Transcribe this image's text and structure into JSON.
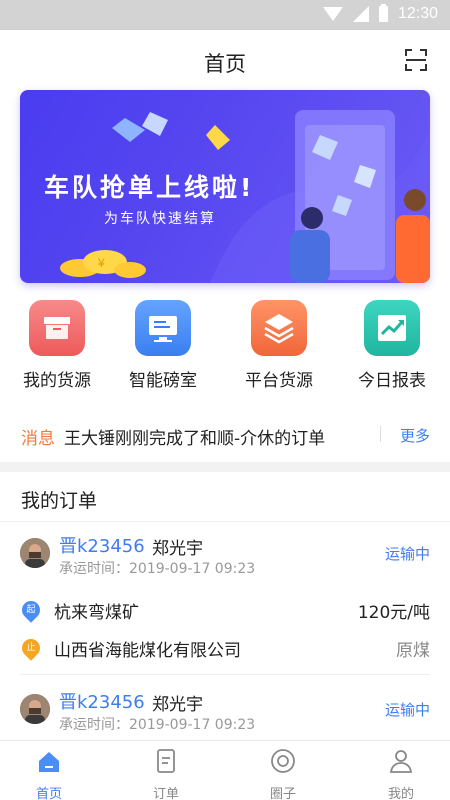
{
  "status_bar": {
    "time": "12:30"
  },
  "header": {
    "title": "首页"
  },
  "banner": {
    "headline": "车队抢单上线啦!",
    "subtitle": "为车队快速结算"
  },
  "quick_actions": [
    {
      "label": "我的货源",
      "icon": "box-icon",
      "color": "#f26a6a"
    },
    {
      "label": "智能磅室",
      "icon": "monitor-icon",
      "color": "#4a8ef5"
    },
    {
      "label": "平台货源",
      "icon": "layers-icon",
      "color": "#f47d52"
    },
    {
      "label": "今日报表",
      "icon": "trend-chart-icon",
      "color": "#2fc5b0"
    }
  ],
  "notice": {
    "tag": "消息",
    "message": "王大锤刚刚完成了和顺-介休的订单",
    "more": "更多"
  },
  "orders_section": {
    "title": "我的订单"
  },
  "orders": [
    {
      "plate": "晋k23456",
      "driver": "郑光宇",
      "time": "承运时间：2019-09-17  09:23",
      "status": "运输中",
      "origin_tag": "起",
      "origin": "杭来弯煤矿",
      "price": "120元/吨",
      "dest_tag": "止",
      "destination": "山西省海能煤化有限公司",
      "cargo": "原煤"
    },
    {
      "plate": "晋k23456",
      "driver": "郑光宇",
      "time": "承运时间：2019-09-17  09:23",
      "status": "运输中"
    }
  ],
  "tabbar": [
    {
      "label": "首页",
      "icon": "home-icon",
      "active": true
    },
    {
      "label": "订单",
      "icon": "order-doc-icon",
      "active": false
    },
    {
      "label": "圈子",
      "icon": "circle-icon",
      "active": false
    },
    {
      "label": "我的",
      "icon": "user-icon",
      "active": false
    }
  ],
  "colors": {
    "accent": "#3f7cf0",
    "notice_tag": "#f07a38",
    "origin_pin": "#4a8ef5",
    "dest_pin": "#f5a623"
  }
}
